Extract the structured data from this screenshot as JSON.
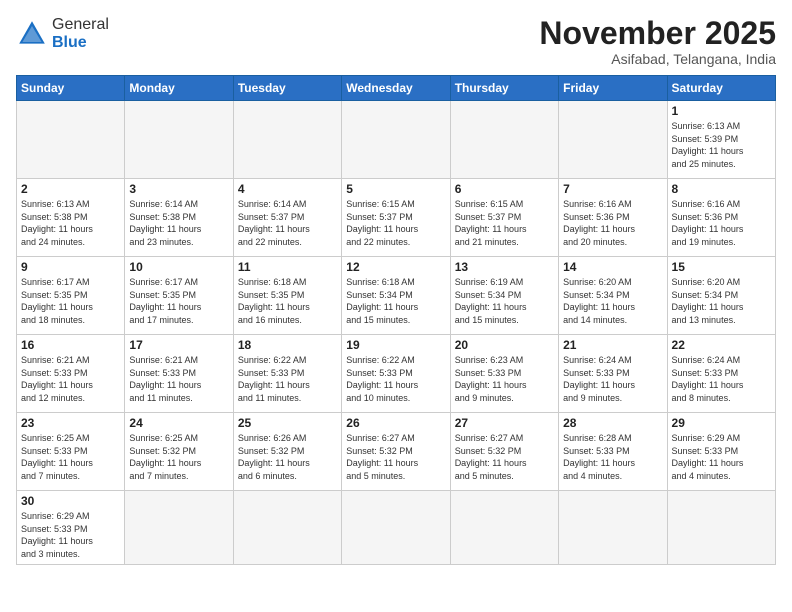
{
  "logo": {
    "general": "General",
    "blue": "Blue"
  },
  "header": {
    "month": "November 2025",
    "location": "Asifabad, Telangana, India"
  },
  "weekdays": [
    "Sunday",
    "Monday",
    "Tuesday",
    "Wednesday",
    "Thursday",
    "Friday",
    "Saturday"
  ],
  "weeks": [
    [
      {
        "day": "",
        "info": ""
      },
      {
        "day": "",
        "info": ""
      },
      {
        "day": "",
        "info": ""
      },
      {
        "day": "",
        "info": ""
      },
      {
        "day": "",
        "info": ""
      },
      {
        "day": "",
        "info": ""
      },
      {
        "day": "1",
        "info": "Sunrise: 6:13 AM\nSunset: 5:39 PM\nDaylight: 11 hours\nand 25 minutes."
      }
    ],
    [
      {
        "day": "2",
        "info": "Sunrise: 6:13 AM\nSunset: 5:38 PM\nDaylight: 11 hours\nand 24 minutes."
      },
      {
        "day": "3",
        "info": "Sunrise: 6:14 AM\nSunset: 5:38 PM\nDaylight: 11 hours\nand 23 minutes."
      },
      {
        "day": "4",
        "info": "Sunrise: 6:14 AM\nSunset: 5:37 PM\nDaylight: 11 hours\nand 22 minutes."
      },
      {
        "day": "5",
        "info": "Sunrise: 6:15 AM\nSunset: 5:37 PM\nDaylight: 11 hours\nand 22 minutes."
      },
      {
        "day": "6",
        "info": "Sunrise: 6:15 AM\nSunset: 5:37 PM\nDaylight: 11 hours\nand 21 minutes."
      },
      {
        "day": "7",
        "info": "Sunrise: 6:16 AM\nSunset: 5:36 PM\nDaylight: 11 hours\nand 20 minutes."
      },
      {
        "day": "8",
        "info": "Sunrise: 6:16 AM\nSunset: 5:36 PM\nDaylight: 11 hours\nand 19 minutes."
      }
    ],
    [
      {
        "day": "9",
        "info": "Sunrise: 6:17 AM\nSunset: 5:35 PM\nDaylight: 11 hours\nand 18 minutes."
      },
      {
        "day": "10",
        "info": "Sunrise: 6:17 AM\nSunset: 5:35 PM\nDaylight: 11 hours\nand 17 minutes."
      },
      {
        "day": "11",
        "info": "Sunrise: 6:18 AM\nSunset: 5:35 PM\nDaylight: 11 hours\nand 16 minutes."
      },
      {
        "day": "12",
        "info": "Sunrise: 6:18 AM\nSunset: 5:34 PM\nDaylight: 11 hours\nand 15 minutes."
      },
      {
        "day": "13",
        "info": "Sunrise: 6:19 AM\nSunset: 5:34 PM\nDaylight: 11 hours\nand 15 minutes."
      },
      {
        "day": "14",
        "info": "Sunrise: 6:20 AM\nSunset: 5:34 PM\nDaylight: 11 hours\nand 14 minutes."
      },
      {
        "day": "15",
        "info": "Sunrise: 6:20 AM\nSunset: 5:34 PM\nDaylight: 11 hours\nand 13 minutes."
      }
    ],
    [
      {
        "day": "16",
        "info": "Sunrise: 6:21 AM\nSunset: 5:33 PM\nDaylight: 11 hours\nand 12 minutes."
      },
      {
        "day": "17",
        "info": "Sunrise: 6:21 AM\nSunset: 5:33 PM\nDaylight: 11 hours\nand 11 minutes."
      },
      {
        "day": "18",
        "info": "Sunrise: 6:22 AM\nSunset: 5:33 PM\nDaylight: 11 hours\nand 11 minutes."
      },
      {
        "day": "19",
        "info": "Sunrise: 6:22 AM\nSunset: 5:33 PM\nDaylight: 11 hours\nand 10 minutes."
      },
      {
        "day": "20",
        "info": "Sunrise: 6:23 AM\nSunset: 5:33 PM\nDaylight: 11 hours\nand 9 minutes."
      },
      {
        "day": "21",
        "info": "Sunrise: 6:24 AM\nSunset: 5:33 PM\nDaylight: 11 hours\nand 9 minutes."
      },
      {
        "day": "22",
        "info": "Sunrise: 6:24 AM\nSunset: 5:33 PM\nDaylight: 11 hours\nand 8 minutes."
      }
    ],
    [
      {
        "day": "23",
        "info": "Sunrise: 6:25 AM\nSunset: 5:33 PM\nDaylight: 11 hours\nand 7 minutes."
      },
      {
        "day": "24",
        "info": "Sunrise: 6:25 AM\nSunset: 5:32 PM\nDaylight: 11 hours\nand 7 minutes."
      },
      {
        "day": "25",
        "info": "Sunrise: 6:26 AM\nSunset: 5:32 PM\nDaylight: 11 hours\nand 6 minutes."
      },
      {
        "day": "26",
        "info": "Sunrise: 6:27 AM\nSunset: 5:32 PM\nDaylight: 11 hours\nand 5 minutes."
      },
      {
        "day": "27",
        "info": "Sunrise: 6:27 AM\nSunset: 5:32 PM\nDaylight: 11 hours\nand 5 minutes."
      },
      {
        "day": "28",
        "info": "Sunrise: 6:28 AM\nSunset: 5:33 PM\nDaylight: 11 hours\nand 4 minutes."
      },
      {
        "day": "29",
        "info": "Sunrise: 6:29 AM\nSunset: 5:33 PM\nDaylight: 11 hours\nand 4 minutes."
      }
    ],
    [
      {
        "day": "30",
        "info": "Sunrise: 6:29 AM\nSunset: 5:33 PM\nDaylight: 11 hours\nand 3 minutes."
      },
      {
        "day": "",
        "info": ""
      },
      {
        "day": "",
        "info": ""
      },
      {
        "day": "",
        "info": ""
      },
      {
        "day": "",
        "info": ""
      },
      {
        "day": "",
        "info": ""
      },
      {
        "day": "",
        "info": ""
      }
    ]
  ]
}
